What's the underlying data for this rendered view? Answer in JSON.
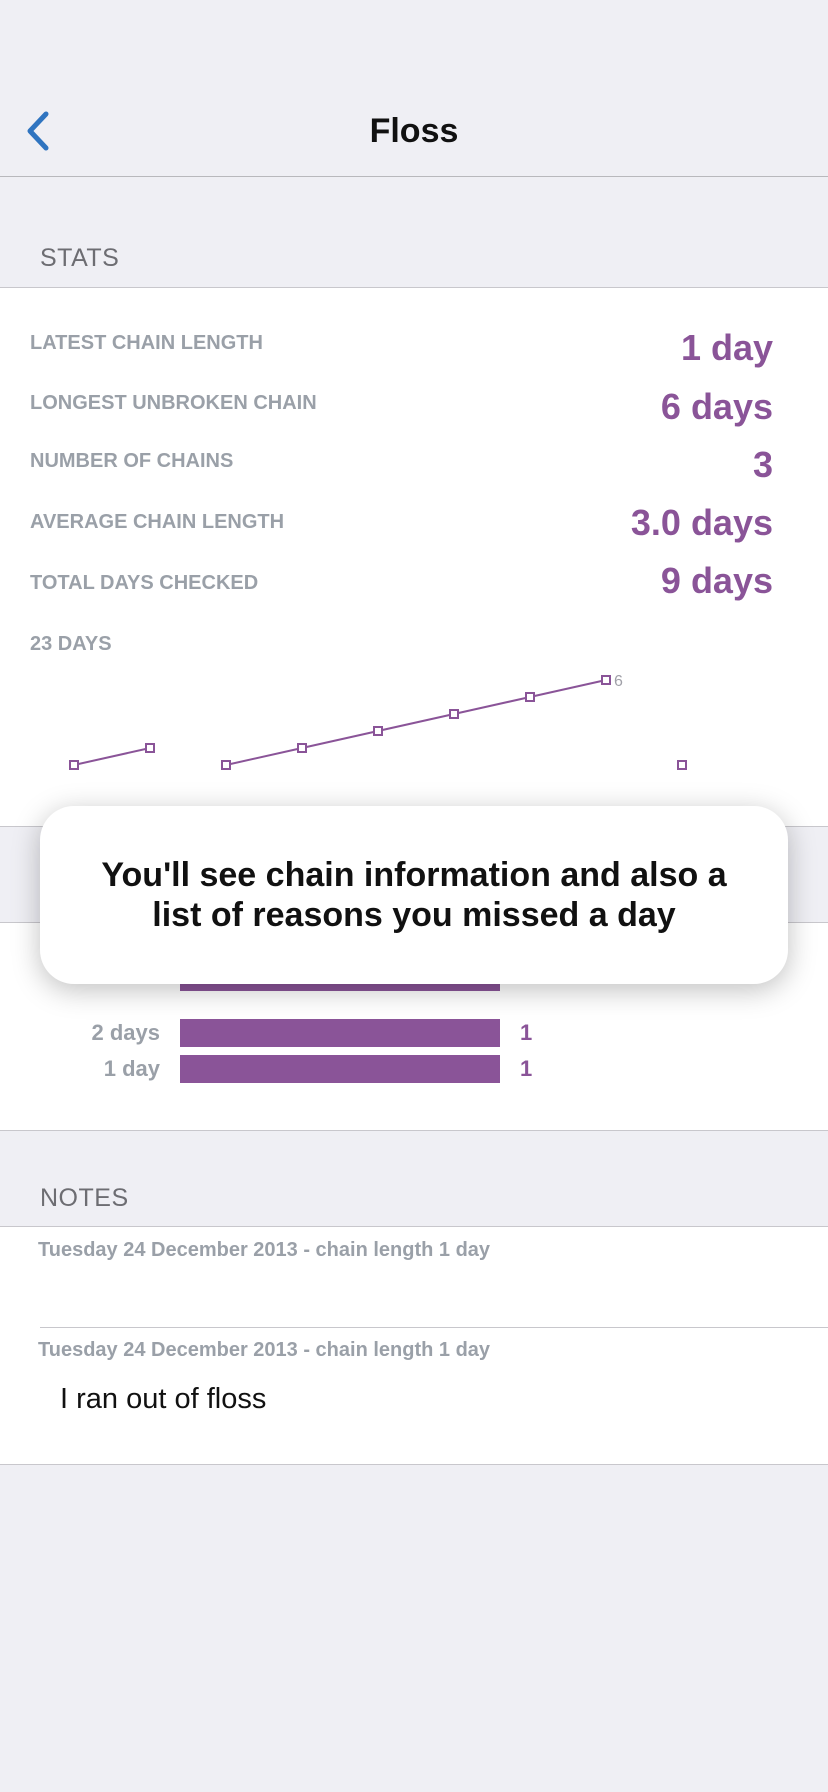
{
  "nav": {
    "title": "Floss",
    "back_icon": "chevron-left-icon",
    "accent": "#2f74c0"
  },
  "stats": {
    "header": "STATS",
    "rows": [
      {
        "label": "LATEST CHAIN LENGTH",
        "value": "1 day"
      },
      {
        "label": "LONGEST UNBROKEN CHAIN",
        "value": "6 days"
      },
      {
        "label": "NUMBER OF CHAINS",
        "value": "3"
      },
      {
        "label": "AVERAGE CHAIN LENGTH",
        "value": "3.0 days"
      },
      {
        "label": "TOTAL DAYS CHECKED",
        "value": "9 days"
      }
    ],
    "range_label": "23 DAYS"
  },
  "chart_data": {
    "type": "line",
    "series": [
      {
        "x": [
          1,
          2
        ],
        "values": [
          1,
          2
        ]
      },
      {
        "x": [
          3,
          4,
          5,
          6,
          7,
          8
        ],
        "values": [
          1,
          2,
          3,
          4,
          5,
          6
        ]
      },
      {
        "x": [
          9
        ],
        "values": [
          1
        ]
      }
    ],
    "annotations": [
      "6"
    ],
    "color": "#8a5498"
  },
  "distribution": {
    "rows": [
      {
        "label": "",
        "count": 1
      },
      {
        "label": "2 days",
        "count": 1
      },
      {
        "label": "1 day",
        "count": 1
      }
    ],
    "color": "#8a5498"
  },
  "notes": {
    "header": "NOTES",
    "items": [
      {
        "heading": "Tuesday 24 December 2013 - chain length 1 day",
        "text": ""
      },
      {
        "heading": "Tuesday 24 December 2013 - chain length 1 day",
        "text": "I ran out of floss"
      }
    ]
  },
  "tooltip": {
    "text": "You'll see chain information and also a list of reasons you missed a day"
  }
}
